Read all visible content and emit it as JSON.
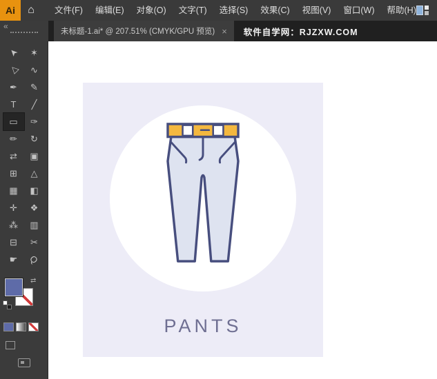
{
  "menu_bar": {
    "logo_text": "Ai",
    "home_icon": "⌂",
    "items": [
      {
        "id": "file",
        "label": "文件(F)"
      },
      {
        "id": "edit",
        "label": "编辑(E)"
      },
      {
        "id": "object",
        "label": "对象(O)"
      },
      {
        "id": "type",
        "label": "文字(T)"
      },
      {
        "id": "select",
        "label": "选择(S)"
      },
      {
        "id": "effect",
        "label": "效果(C)"
      },
      {
        "id": "view",
        "label": "视图(V)"
      },
      {
        "id": "window",
        "label": "窗口(W)"
      },
      {
        "id": "help",
        "label": "帮助(H)"
      }
    ]
  },
  "tab_bar": {
    "collapse": "«",
    "document_tab": {
      "label": "未标题-1.ai* @ 207.51% (CMYK/GPU 预览)",
      "close": "×"
    },
    "watermark": "软件自学网：RJZXW.COM"
  },
  "toolbar": {
    "fill_color": "#5E6BA8",
    "tools": [
      {
        "name": "selection",
        "glyph": "➤",
        "rot": -135
      },
      {
        "name": "magic-wand",
        "glyph": "✶"
      },
      {
        "name": "direct-selection",
        "glyph": "▷",
        "rot": -135
      },
      {
        "name": "lasso",
        "glyph": "∿"
      },
      {
        "name": "pen",
        "glyph": "✒"
      },
      {
        "name": "curvature",
        "glyph": "✎"
      },
      {
        "name": "type",
        "glyph": "T"
      },
      {
        "name": "line-segment",
        "glyph": "╱"
      },
      {
        "name": "rectangle",
        "glyph": "▭",
        "selected": true
      },
      {
        "name": "paintbrush",
        "glyph": "✑"
      },
      {
        "name": "pencil",
        "glyph": "✏"
      },
      {
        "name": "rotate",
        "glyph": "↻"
      },
      {
        "name": "width",
        "glyph": "⇄"
      },
      {
        "name": "free-transform",
        "glyph": "▣"
      },
      {
        "name": "shape-builder",
        "glyph": "⊞"
      },
      {
        "name": "perspective-grid",
        "glyph": "△"
      },
      {
        "name": "mesh",
        "glyph": "▦"
      },
      {
        "name": "gradient",
        "glyph": "◧"
      },
      {
        "name": "eyedropper",
        "glyph": "✛"
      },
      {
        "name": "blend",
        "glyph": "❖"
      },
      {
        "name": "symbol-sprayer",
        "glyph": "⁂"
      },
      {
        "name": "column-graph",
        "glyph": "▥"
      },
      {
        "name": "artboard",
        "glyph": "⊟"
      },
      {
        "name": "slice",
        "glyph": "✂"
      },
      {
        "name": "hand",
        "glyph": "☛"
      },
      {
        "name": "zoom",
        "glyph": "Q",
        "rot": 45
      }
    ]
  },
  "artwork": {
    "panel_bg": "#EDECF7",
    "circle_color": "#FFFFFF",
    "label": "PANTS",
    "label_color": "#6F6F92",
    "pants": {
      "outline": "#474E7E",
      "fill": "#DEE3F0",
      "band": "#F4B83F",
      "white": "#FFFFFF"
    }
  }
}
